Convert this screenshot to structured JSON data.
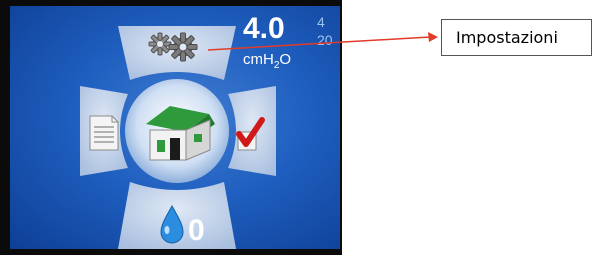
{
  "device_screen": {
    "pressure": {
      "value": "4.0",
      "unit_main": "cmH",
      "unit_sub": "2",
      "unit_tail": "O"
    },
    "ramp": {
      "top": "4",
      "bottom": "20"
    },
    "humidity_level": "0",
    "icons": {
      "top": "gear-icon",
      "left": "document-icon",
      "center": "home-icon",
      "right": "checkmark-icon",
      "bottom": "water-drop-icon"
    }
  },
  "callout": {
    "label": "Impostazioni",
    "arrow_color": "#e23b2a"
  },
  "colors": {
    "screen_blue": "#1f5fbf",
    "petal": "#c5d6ee",
    "home_green": "#2e9a3c",
    "check_red": "#d01a1a"
  }
}
